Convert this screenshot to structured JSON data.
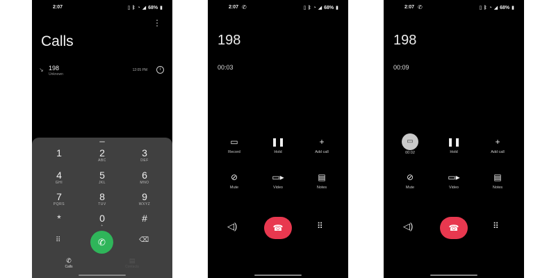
{
  "status": {
    "time": "2:07",
    "battery": "68%",
    "call_icon": "call-indicator-icon",
    "icons": [
      "vibrate-icon",
      "bluetooth-icon",
      "wifi-icon",
      "signal-icon",
      "battery-icon"
    ]
  },
  "calls_screen": {
    "title": "Calls",
    "log": [
      {
        "number": "198",
        "subtitle": "Unknown",
        "time": "12:05 PM"
      }
    ],
    "keys": [
      {
        "digit": "1",
        "letters": ""
      },
      {
        "digit": "2",
        "letters": "ABC"
      },
      {
        "digit": "3",
        "letters": "DEF"
      },
      {
        "digit": "4",
        "letters": "GHI"
      },
      {
        "digit": "5",
        "letters": "JKL"
      },
      {
        "digit": "6",
        "letters": "MNO"
      },
      {
        "digit": "7",
        "letters": "PQRS"
      },
      {
        "digit": "8",
        "letters": "TUV"
      },
      {
        "digit": "9",
        "letters": "WXYZ"
      },
      {
        "digit": "*",
        "letters": ""
      },
      {
        "digit": "0",
        "letters": "+"
      },
      {
        "digit": "#",
        "letters": ""
      }
    ],
    "tabs": [
      {
        "label": "Calls"
      },
      {
        "label": "Contacts"
      }
    ]
  },
  "ongoing_1": {
    "number": "198",
    "timer": "00:03",
    "controls": {
      "record": "Record",
      "hold": "Hold",
      "add_call": "Add call",
      "mute": "Mute",
      "video": "Video",
      "notes": "Notes"
    }
  },
  "ongoing_2": {
    "number": "198",
    "timer": "00:09",
    "controls": {
      "record": "00:02",
      "hold": "Hold",
      "add_call": "Add call",
      "mute": "Mute",
      "video": "Video",
      "notes": "Notes"
    }
  },
  "colors": {
    "call_green": "#2fb55a",
    "end_red": "#e8384f",
    "dialpad_bg": "#404040",
    "screen_bg": "#000000"
  }
}
